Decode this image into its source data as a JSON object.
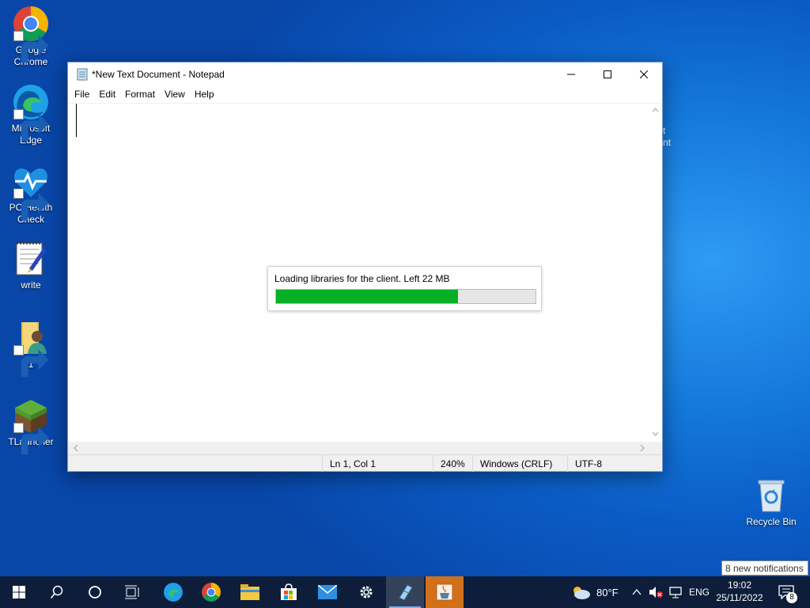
{
  "desktop": {
    "icons": [
      {
        "label": "Google Chrome"
      },
      {
        "label": "Microsoft Edge"
      },
      {
        "label": "PC Health Check"
      },
      {
        "label": "write"
      },
      {
        "label": "1"
      },
      {
        "label": "TLauncher"
      },
      {
        "label": "Recycle Bin"
      }
    ],
    "partial_label_1": "t",
    "partial_label_2": "nt"
  },
  "notepad": {
    "title": "*New Text Document - Notepad",
    "menu": [
      "File",
      "Edit",
      "Format",
      "View",
      "Help"
    ],
    "status": {
      "position": "Ln 1, Col 1",
      "zoom": "240%",
      "line_ending": "Windows (CRLF)",
      "encoding": "UTF-8"
    }
  },
  "loader": {
    "message": "Loading libraries for the client. Left 22 MB",
    "progress_percent": 70
  },
  "taskbar": {
    "weather_temp": "80°F",
    "language": "ENG",
    "time": "19:02",
    "date": "25/11/2022",
    "notification_count": "8",
    "notification_tooltip": "8 new notifications"
  },
  "colors": {
    "progress_fill": "#06b025",
    "taskbar": "#0e1e3a",
    "java_highlight": "#d0701a"
  }
}
